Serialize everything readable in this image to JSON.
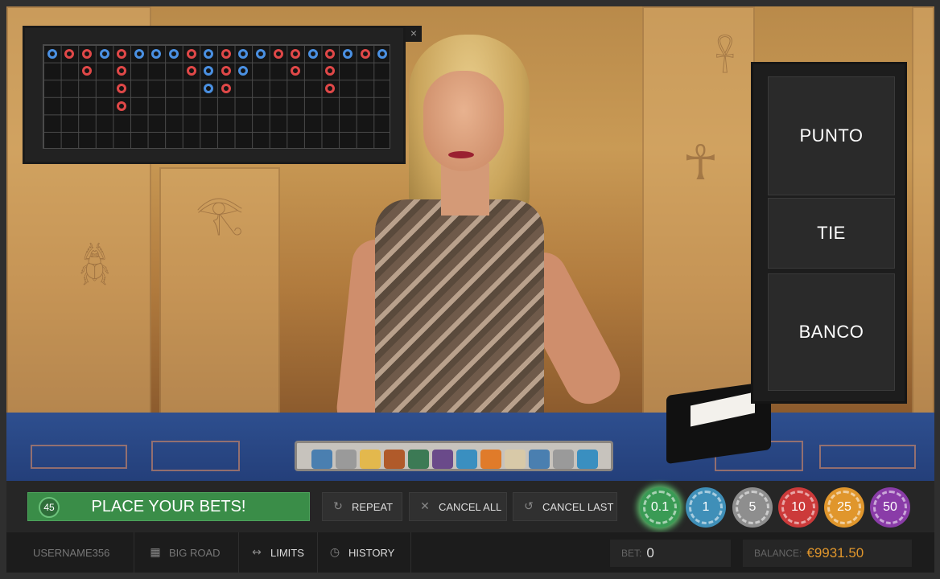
{
  "scoreboard": {
    "close_label": "×",
    "results": [
      {
        "col": 0,
        "row": 0,
        "side": "P"
      },
      {
        "col": 1,
        "row": 0,
        "side": "B"
      },
      {
        "col": 2,
        "row": 0,
        "side": "B"
      },
      {
        "col": 2,
        "row": 1,
        "side": "B"
      },
      {
        "col": 3,
        "row": 0,
        "side": "P"
      },
      {
        "col": 4,
        "row": 0,
        "side": "B"
      },
      {
        "col": 4,
        "row": 1,
        "side": "B"
      },
      {
        "col": 4,
        "row": 2,
        "side": "B"
      },
      {
        "col": 4,
        "row": 3,
        "side": "B"
      },
      {
        "col": 5,
        "row": 0,
        "side": "P"
      },
      {
        "col": 6,
        "row": 0,
        "side": "P"
      },
      {
        "col": 7,
        "row": 0,
        "side": "P"
      },
      {
        "col": 8,
        "row": 0,
        "side": "B"
      },
      {
        "col": 8,
        "row": 1,
        "side": "B"
      },
      {
        "col": 9,
        "row": 0,
        "side": "P"
      },
      {
        "col": 9,
        "row": 1,
        "side": "P"
      },
      {
        "col": 9,
        "row": 2,
        "side": "P"
      },
      {
        "col": 10,
        "row": 0,
        "side": "B"
      },
      {
        "col": 10,
        "row": 1,
        "side": "B"
      },
      {
        "col": 10,
        "row": 2,
        "side": "B"
      },
      {
        "col": 11,
        "row": 0,
        "side": "P"
      },
      {
        "col": 11,
        "row": 1,
        "side": "P"
      },
      {
        "col": 12,
        "row": 0,
        "side": "P"
      },
      {
        "col": 13,
        "row": 0,
        "side": "B"
      },
      {
        "col": 14,
        "row": 0,
        "side": "B"
      },
      {
        "col": 14,
        "row": 1,
        "side": "B"
      },
      {
        "col": 15,
        "row": 0,
        "side": "P"
      },
      {
        "col": 16,
        "row": 0,
        "side": "B"
      },
      {
        "col": 16,
        "row": 1,
        "side": "B"
      },
      {
        "col": 16,
        "row": 2,
        "side": "B"
      },
      {
        "col": 17,
        "row": 0,
        "side": "P"
      },
      {
        "col": 18,
        "row": 0,
        "side": "B"
      },
      {
        "col": 19,
        "row": 0,
        "side": "P"
      }
    ]
  },
  "bet_spots": {
    "punto": "PUNTO",
    "tie": "TIE",
    "banco": "BANCO"
  },
  "controls": {
    "timer": "45",
    "status_message": "PLACE YOUR BETS!",
    "repeat": "REPEAT",
    "cancel_all": "CANCEL ALL",
    "cancel_last": "CANCEL LAST"
  },
  "chips": [
    {
      "label": "0.1",
      "color": "#3a9b55",
      "selected": true
    },
    {
      "label": "1",
      "color": "#3f8fb8"
    },
    {
      "label": "5",
      "color": "#8e8e8e"
    },
    {
      "label": "10",
      "color": "#cc3a3a"
    },
    {
      "label": "25",
      "color": "#e0962c"
    },
    {
      "label": "50",
      "color": "#8a3ca8"
    }
  ],
  "status_bar": {
    "username": "USERNAME356",
    "big_road": "BIG ROAD",
    "limits": "LIMITS",
    "history": "HISTORY",
    "bet_label": "BET:",
    "bet_value": "0",
    "balance_label": "BALANCE:",
    "balance_value": "€9931.50",
    "balance_color": "#e0962c"
  },
  "colors": {
    "player": "#4a90e2",
    "banker": "#e04848",
    "place_bets_bg": "#3a8d48"
  }
}
